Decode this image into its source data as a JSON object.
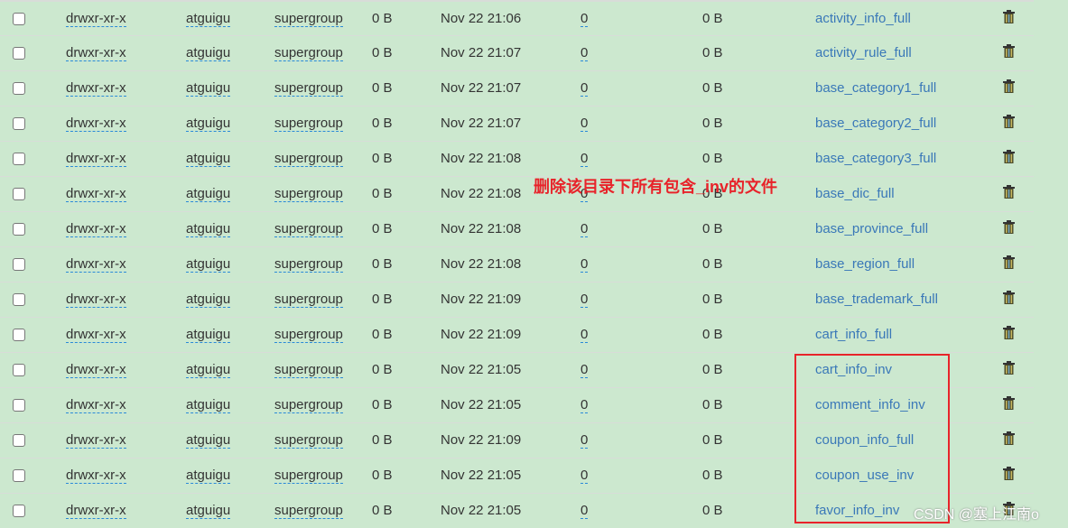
{
  "rows": [
    {
      "perm": "drwxr-xr-x",
      "owner": "atguigu",
      "group": "supergroup",
      "size": "0 B",
      "date": "Nov 22 21:06",
      "replication": "0",
      "block": "0 B",
      "name": "activity_info_full"
    },
    {
      "perm": "drwxr-xr-x",
      "owner": "atguigu",
      "group": "supergroup",
      "size": "0 B",
      "date": "Nov 22 21:07",
      "replication": "0",
      "block": "0 B",
      "name": "activity_rule_full"
    },
    {
      "perm": "drwxr-xr-x",
      "owner": "atguigu",
      "group": "supergroup",
      "size": "0 B",
      "date": "Nov 22 21:07",
      "replication": "0",
      "block": "0 B",
      "name": "base_category1_full"
    },
    {
      "perm": "drwxr-xr-x",
      "owner": "atguigu",
      "group": "supergroup",
      "size": "0 B",
      "date": "Nov 22 21:07",
      "replication": "0",
      "block": "0 B",
      "name": "base_category2_full"
    },
    {
      "perm": "drwxr-xr-x",
      "owner": "atguigu",
      "group": "supergroup",
      "size": "0 B",
      "date": "Nov 22 21:08",
      "replication": "0",
      "block": "0 B",
      "name": "base_category3_full"
    },
    {
      "perm": "drwxr-xr-x",
      "owner": "atguigu",
      "group": "supergroup",
      "size": "0 B",
      "date": "Nov 22 21:08",
      "replication": "0",
      "block": "0 B",
      "name": "base_dic_full"
    },
    {
      "perm": "drwxr-xr-x",
      "owner": "atguigu",
      "group": "supergroup",
      "size": "0 B",
      "date": "Nov 22 21:08",
      "replication": "0",
      "block": "0 B",
      "name": "base_province_full"
    },
    {
      "perm": "drwxr-xr-x",
      "owner": "atguigu",
      "group": "supergroup",
      "size": "0 B",
      "date": "Nov 22 21:08",
      "replication": "0",
      "block": "0 B",
      "name": "base_region_full"
    },
    {
      "perm": "drwxr-xr-x",
      "owner": "atguigu",
      "group": "supergroup",
      "size": "0 B",
      "date": "Nov 22 21:09",
      "replication": "0",
      "block": "0 B",
      "name": "base_trademark_full"
    },
    {
      "perm": "drwxr-xr-x",
      "owner": "atguigu",
      "group": "supergroup",
      "size": "0 B",
      "date": "Nov 22 21:09",
      "replication": "0",
      "block": "0 B",
      "name": "cart_info_full"
    },
    {
      "perm": "drwxr-xr-x",
      "owner": "atguigu",
      "group": "supergroup",
      "size": "0 B",
      "date": "Nov 22 21:05",
      "replication": "0",
      "block": "0 B",
      "name": "cart_info_inv"
    },
    {
      "perm": "drwxr-xr-x",
      "owner": "atguigu",
      "group": "supergroup",
      "size": "0 B",
      "date": "Nov 22 21:05",
      "replication": "0",
      "block": "0 B",
      "name": "comment_info_inv"
    },
    {
      "perm": "drwxr-xr-x",
      "owner": "atguigu",
      "group": "supergroup",
      "size": "0 B",
      "date": "Nov 22 21:09",
      "replication": "0",
      "block": "0 B",
      "name": "coupon_info_full"
    },
    {
      "perm": "drwxr-xr-x",
      "owner": "atguigu",
      "group": "supergroup",
      "size": "0 B",
      "date": "Nov 22 21:05",
      "replication": "0",
      "block": "0 B",
      "name": "coupon_use_inv"
    },
    {
      "perm": "drwxr-xr-x",
      "owner": "atguigu",
      "group": "supergroup",
      "size": "0 B",
      "date": "Nov 22 21:05",
      "replication": "0",
      "block": "0 B",
      "name": "favor_info_inv"
    }
  ],
  "annotation": "删除该目录下所有包含_inv的文件",
  "watermark": "CSDN @塞上江南o",
  "colors": {
    "background": "#cce8cf",
    "link": "#3a78b8",
    "highlight": "#e8232a"
  },
  "icons": {
    "delete": "trash-icon"
  }
}
